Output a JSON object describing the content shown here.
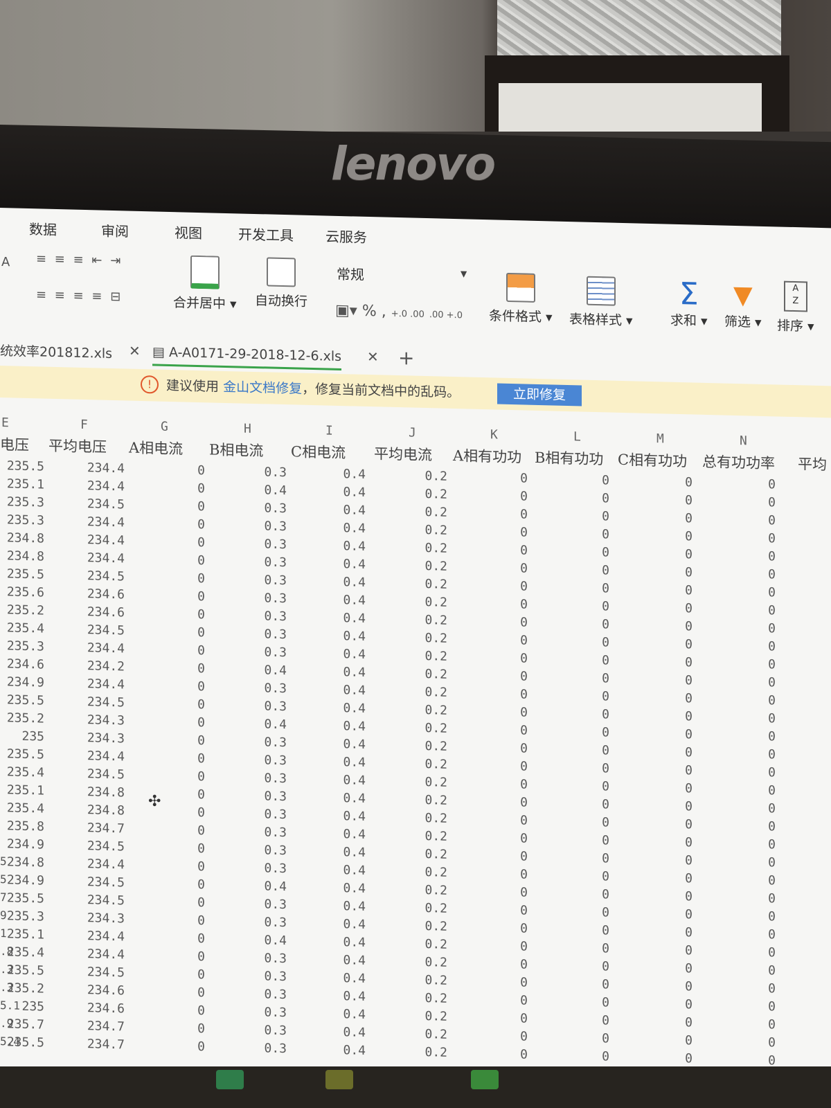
{
  "monitor": {
    "brand": "lenovo"
  },
  "menu": [
    "数据",
    "审阅",
    "视图",
    "开发工具",
    "云服务"
  ],
  "ribbon": {
    "font_size_label": "A",
    "merge_center": "合并居中",
    "wrap_text": "自动换行",
    "number_format": "常规",
    "percent": "%",
    "comma": ",",
    "inc_decimal": "+.0 .00",
    "dec_decimal": ".00 +.0",
    "conditional_format": "条件格式",
    "table_style": "表格样式",
    "sum": "求和",
    "filter": "筛选",
    "sort": "排序"
  },
  "tabs": [
    {
      "label": "统效率201812.xls"
    },
    {
      "label": "A-A0171-29-2018-12-6.xls"
    }
  ],
  "notice": {
    "prefix": "建议使用",
    "link": "金山文档修复",
    "suffix": "，修复当前文档中的乱码。",
    "button": "立即修复"
  },
  "columns": {
    "letters": [
      "E",
      "F",
      "G",
      "H",
      "I",
      "J",
      "K",
      "L",
      "M",
      "N"
    ],
    "headers": [
      "电压",
      "平均电压",
      "A相电流",
      "B相电流",
      "C相电流",
      "平均电流",
      "A相有功功",
      "B相有功功",
      "C相有功功",
      "总有功功率",
      "平均"
    ]
  },
  "rows": [
    [
      "235.5",
      "234.4",
      "0",
      "0.3",
      "0.4",
      "0.2",
      "0",
      "0",
      "0",
      "0"
    ],
    [
      "235.1",
      "234.4",
      "0",
      "0.4",
      "0.4",
      "0.2",
      "0",
      "0",
      "0",
      "0"
    ],
    [
      "235.3",
      "234.5",
      "0",
      "0.3",
      "0.4",
      "0.2",
      "0",
      "0",
      "0",
      "0"
    ],
    [
      "235.3",
      "234.4",
      "0",
      "0.3",
      "0.4",
      "0.2",
      "0",
      "0",
      "0",
      "0"
    ],
    [
      "234.8",
      "234.4",
      "0",
      "0.3",
      "0.4",
      "0.2",
      "0",
      "0",
      "0",
      "0"
    ],
    [
      "234.8",
      "234.4",
      "0",
      "0.3",
      "0.4",
      "0.2",
      "0",
      "0",
      "0",
      "0"
    ],
    [
      "235.5",
      "234.5",
      "0",
      "0.3",
      "0.4",
      "0.2",
      "0",
      "0",
      "0",
      "0"
    ],
    [
      "235.6",
      "234.6",
      "0",
      "0.3",
      "0.4",
      "0.2",
      "0",
      "0",
      "0",
      "0"
    ],
    [
      "235.2",
      "234.6",
      "0",
      "0.3",
      "0.4",
      "0.2",
      "0",
      "0",
      "0",
      "0"
    ],
    [
      "235.4",
      "234.5",
      "0",
      "0.3",
      "0.4",
      "0.2",
      "0",
      "0",
      "0",
      "0"
    ],
    [
      "235.3",
      "234.4",
      "0",
      "0.3",
      "0.4",
      "0.2",
      "0",
      "0",
      "0",
      "0"
    ],
    [
      "234.6",
      "234.2",
      "0",
      "0.4",
      "0.4",
      "0.2",
      "0",
      "0",
      "0",
      "0"
    ],
    [
      "234.9",
      "234.4",
      "0",
      "0.3",
      "0.4",
      "0.2",
      "0",
      "0",
      "0",
      "0"
    ],
    [
      "235.5",
      "234.5",
      "0",
      "0.3",
      "0.4",
      "0.2",
      "0",
      "0",
      "0",
      "0"
    ],
    [
      "235.2",
      "234.3",
      "0",
      "0.4",
      "0.4",
      "0.2",
      "0",
      "0",
      "0",
      "0"
    ],
    [
      "235",
      "234.3",
      "0",
      "0.3",
      "0.4",
      "0.2",
      "0",
      "0",
      "0",
      "0"
    ],
    [
      "235.5",
      "234.4",
      "0",
      "0.3",
      "0.4",
      "0.2",
      "0",
      "0",
      "0",
      "0"
    ],
    [
      "235.4",
      "234.5",
      "0",
      "0.3",
      "0.4",
      "0.2",
      "0",
      "0",
      "0",
      "0"
    ],
    [
      "235.1",
      "234.8",
      "0",
      "0.3",
      "0.4",
      "0.2",
      "0",
      "0",
      "0",
      "0"
    ],
    [
      "235.4",
      "234.8",
      "0",
      "0.3",
      "0.4",
      "0.2",
      "0",
      "0",
      "0",
      "0"
    ],
    [
      "235.8",
      "234.7",
      "0",
      "0.3",
      "0.4",
      "0.2",
      "0",
      "0",
      "0",
      "0"
    ],
    [
      "234.9",
      "234.5",
      "0",
      "0.3",
      "0.4",
      "0.2",
      "0",
      "0",
      "0",
      "0"
    ],
    [
      "234.8",
      "234.4",
      "0",
      "0.3",
      "0.4",
      "0.2",
      "0",
      "0",
      "0",
      "0"
    ],
    [
      "234.9",
      "234.5",
      "0",
      "0.4",
      "0.4",
      "0.2",
      "0",
      "0",
      "0",
      "0"
    ],
    [
      "235.5",
      "234.5",
      "0",
      "0.3",
      "0.4",
      "0.2",
      "0",
      "0",
      "0",
      "0"
    ],
    [
      "235.3",
      "234.3",
      "0",
      "0.3",
      "0.4",
      "0.2",
      "0",
      "0",
      "0",
      "0"
    ],
    [
      "235.1",
      "234.4",
      "0",
      "0.4",
      "0.4",
      "0.2",
      "0",
      "0",
      "0",
      "0"
    ],
    [
      "235.4",
      "234.4",
      "0",
      "0.3",
      "0.4",
      "0.2",
      "0",
      "0",
      "0",
      "0"
    ],
    [
      "235.5",
      "234.5",
      "0",
      "0.3",
      "0.4",
      "0.2",
      "0",
      "0",
      "0",
      "0"
    ],
    [
      "235.2",
      "234.6",
      "0",
      "0.3",
      "0.4",
      "0.2",
      "0",
      "0",
      "0",
      "0"
    ],
    [
      "235",
      "234.6",
      "0",
      "0.3",
      "0.4",
      "0.2",
      "0",
      "0",
      "0",
      "0"
    ],
    [
      "235.7",
      "234.7",
      "0",
      "0.3",
      "0.4",
      "0.2",
      "0",
      "0",
      "0",
      "0"
    ],
    [
      "235.5",
      "234.7",
      "0",
      "0.3",
      "0.4",
      "0.2",
      "0",
      "0",
      "0",
      "0"
    ]
  ],
  "left_fragments": [
    "5",
    "5",
    "7",
    "9",
    "1",
    ".8",
    ".3",
    ".3",
    "5.1",
    ".9",
    "5.4"
  ]
}
